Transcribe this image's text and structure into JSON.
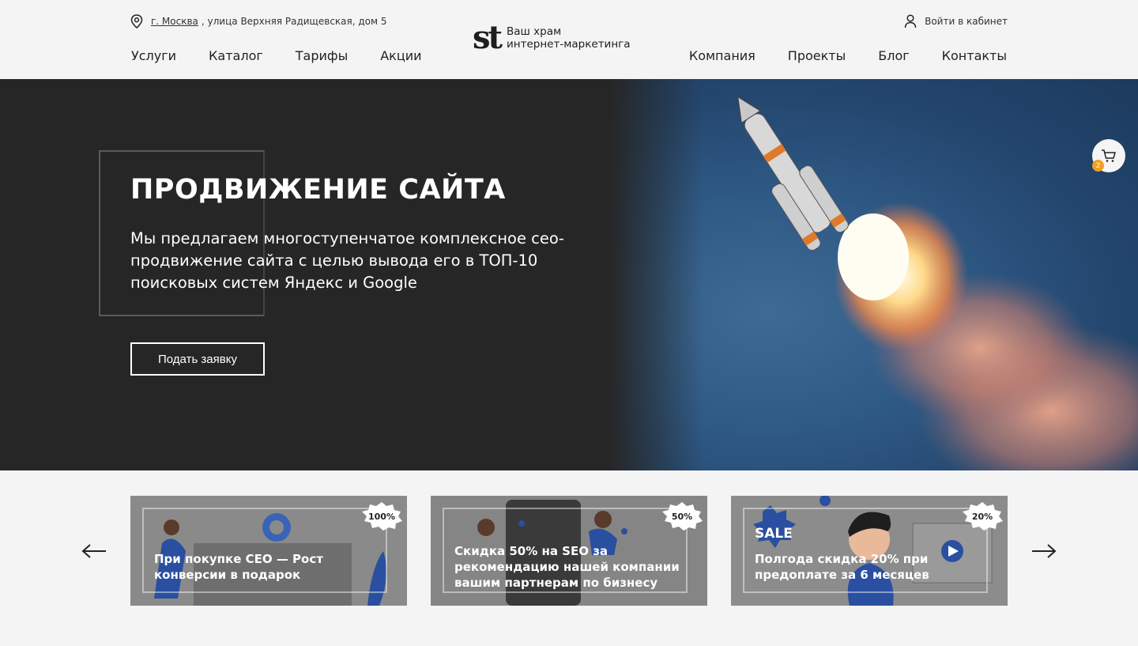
{
  "header": {
    "address_city": "г. Москва",
    "address_rest": ", улица Верхняя Радищевская, дом 5",
    "login_label": "Войти в кабинет",
    "logo_mark": "st",
    "logo_line1": "Ваш храм",
    "logo_line2": "интернет-маркетинга",
    "nav_left": [
      "Услуги",
      "Каталог",
      "Тарифы",
      "Акции"
    ],
    "nav_right": [
      "Компания",
      "Проекты",
      "Блог",
      "Контакты"
    ]
  },
  "hero": {
    "title": "ПРОДВИЖЕНИЕ САЙТА",
    "subtitle": "Мы предлагаем многоступенчатое комплексное сео-продвижение сайта с целью вывода его в ТОП-10 поисковых систем Яндекс и Google",
    "button_label": "Подать заявку"
  },
  "cart": {
    "count": "2"
  },
  "promos": [
    {
      "text": "При покупке СЕО — Рост конверсии в подарок",
      "badge": "100%"
    },
    {
      "text": "Скидка 50% на SEO за рекомендацию нашей компании вашим партнерам по бизнесу",
      "badge": "50%"
    },
    {
      "text": "Полгода скидка 20% при предоплате за 6 месяцев",
      "badge": "20%"
    }
  ],
  "promo_sale_label": "SALE",
  "icons": {
    "location": "location-pin-icon",
    "user": "user-icon",
    "cart": "cart-icon",
    "prev": "arrow-left-icon",
    "next": "arrow-right-icon"
  }
}
